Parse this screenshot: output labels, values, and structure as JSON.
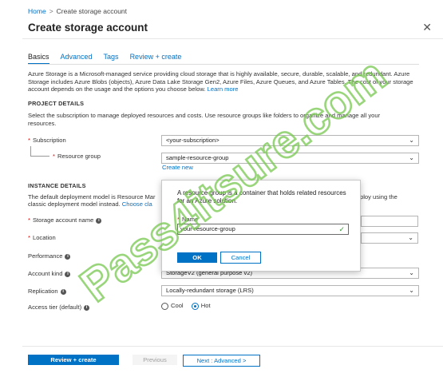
{
  "breadcrumb": {
    "home": "Home",
    "separator": ">",
    "current": "Create storage account"
  },
  "page_title": "Create storage account",
  "close_glyph": "✕",
  "tabs": [
    {
      "label": "Basics",
      "active": true
    },
    {
      "label": "Advanced",
      "active": false
    },
    {
      "label": "Tags",
      "active": false
    },
    {
      "label": "Review + create",
      "active": false
    }
  ],
  "description": {
    "text": "Azure Storage is a Microsoft-managed service providing cloud storage that is highly available, secure, durable, scalable, and redundant. Azure Storage includes Azure Blobs (objects), Azure Data Lake Storage Gen2, Azure Files, Azure Queues, and Azure Tables. The cost of your storage account depends on the usage and the options you choose below.",
    "link": "Learn more"
  },
  "project_details": {
    "heading": "PROJECT DETAILS",
    "text": "Select the subscription to manage deployed resources and costs. Use resource groups like folders to organize and manage all your resources.",
    "subscription_label": "Subscription",
    "subscription_value": "<your-subscription>",
    "resource_group_label": "Resource group",
    "resource_group_value": "sample-resource-group",
    "create_new": "Create new"
  },
  "instance_details": {
    "heading": "INSTANCE DETAILS",
    "text_line1": "The default deployment model is Resource Mar",
    "text_line1_tail": "ploy using the",
    "text_line2": "classic deployment model instead.",
    "text_line2_link": "Choose cla",
    "storage_account_name_label": "Storage account name",
    "location_label": "Location",
    "performance_label": "Performance",
    "account_kind_label": "Account kind",
    "account_kind_value": "StorageV2 (general purpose v2)",
    "replication_label": "Replication",
    "replication_value": "Locally-redundant storage (LRS)",
    "access_tier_label": "Access tier (default)",
    "access_tier_options": [
      "Cool",
      "Hot"
    ],
    "access_tier_selected": "Hot"
  },
  "popup": {
    "message": "A resource group is a container that holds related resources for an Azure solution.",
    "name_label": "Name",
    "name_value": "your-resource-group",
    "ok": "OK",
    "cancel": "Cancel"
  },
  "footer": {
    "review_create": "Review + create",
    "previous": "Previous",
    "next": "Next : Advanced >"
  },
  "watermark": {
    "text": "Pass4itsure.com",
    "color": "#78c850"
  },
  "colors": {
    "accent": "#0072c6",
    "required": "#d00000",
    "valid_check": "#3c9a3c"
  }
}
